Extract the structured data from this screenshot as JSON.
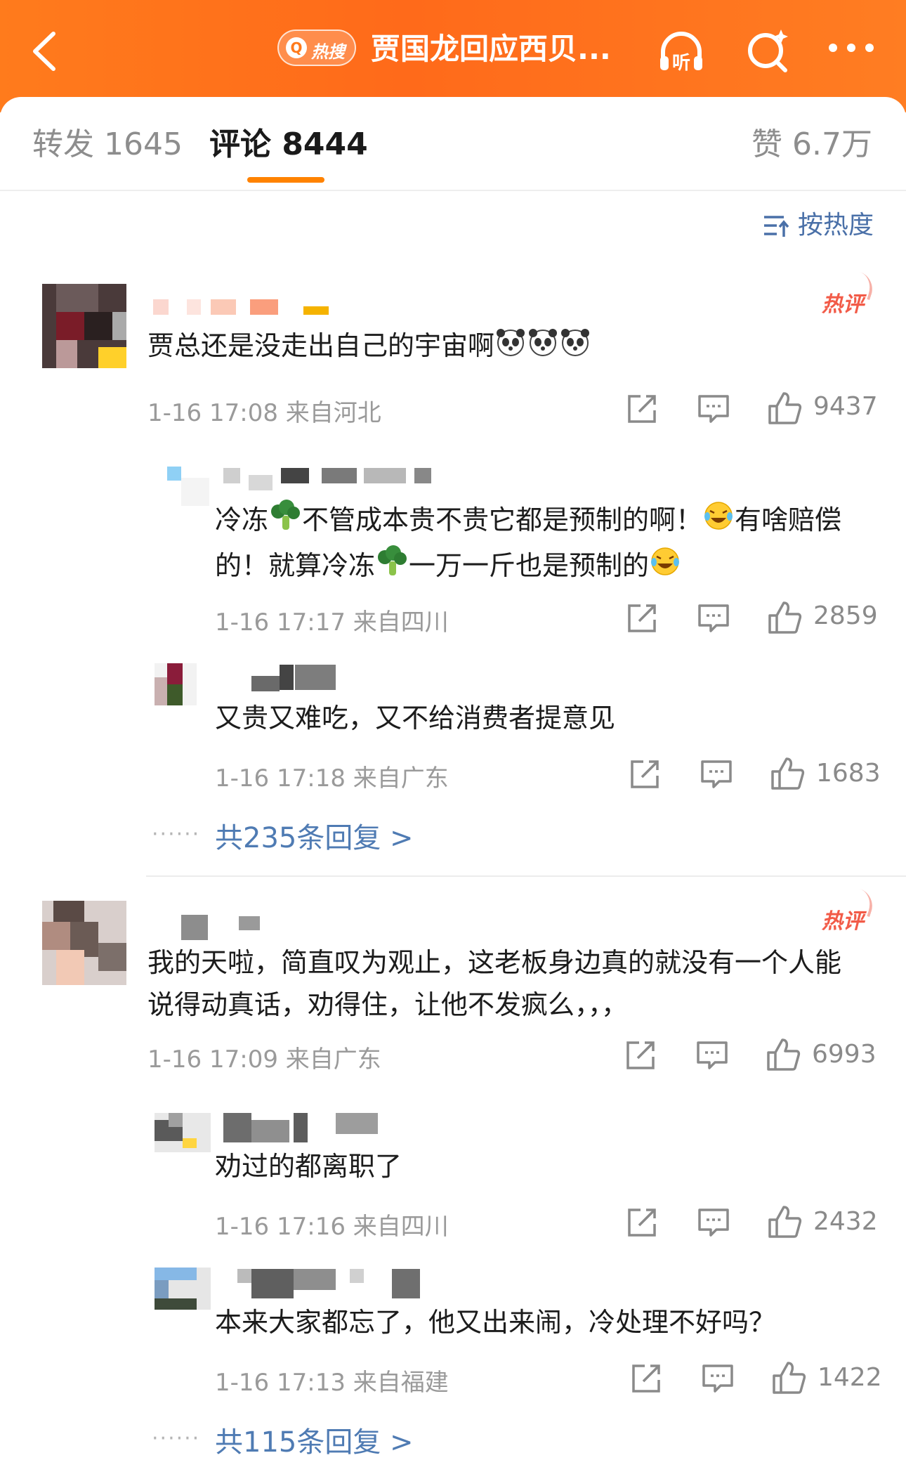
{
  "header": {
    "hot_search_label": "热搜",
    "title": "贾国龙回应西贝...",
    "icons": [
      "back-arrow-icon",
      "headphones-listen-icon",
      "search-sparkle-icon",
      "more-icon"
    ],
    "listen_label": "听"
  },
  "tabs": {
    "repost": "转发 1645",
    "comment": "评论 8444",
    "like": "赞 6.7万"
  },
  "sort_label": "按热度",
  "threads": [
    {
      "hot_label": "热评",
      "text": "贾总还是没走出自己的宇宙啊",
      "emoji": [
        "panda-face",
        "panda-face",
        "panda-face"
      ],
      "meta": "1-16 17:08  来自河北",
      "likes": "9437",
      "replies": [
        {
          "text_a": "冷冻",
          "text_b": "不管成本贵不贵它都是预制的啊！",
          "text_c": "有啥赔偿的！就算冷冻",
          "text_d": "一万一斤也是预制的",
          "meta": "1-16 17:17  来自四川",
          "likes": "2859"
        },
        {
          "text": "又贵又难吃，又不给消费者提意见",
          "meta": "1-16 17:18  来自广东",
          "likes": "1683"
        }
      ],
      "more_replies": "共235条回复 >"
    },
    {
      "hot_label": "热评",
      "text": "我的天啦，简直叹为观止，这老板身边真的就没有一个人能说得动真话，劝得住，让他不发疯么，，，",
      "meta": "1-16 17:09  来自广东",
      "likes": "6993",
      "replies": [
        {
          "text": "劝过的都离职了",
          "meta": "1-16 17:16  来自四川",
          "likes": "2432"
        },
        {
          "text": "本来大家都忘了，他又出来闹，冷处理不好吗？",
          "meta": "1-16 17:13  来自福建",
          "likes": "1422"
        }
      ],
      "more_replies": "共115条回复 >"
    }
  ],
  "more_dots": "······",
  "colors": {
    "brand_orange": "#ff7b1c",
    "tab_underline": "#ff8200",
    "link_blue": "#4f7bb3",
    "hot_red": "#f25b48"
  }
}
